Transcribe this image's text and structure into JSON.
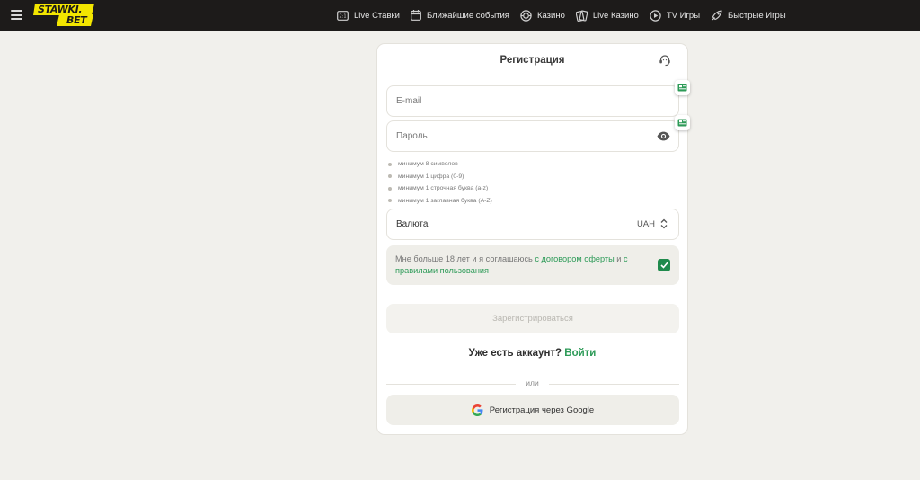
{
  "header": {
    "logo_top": "STAWKI.",
    "logo_bottom": "BET",
    "nav": [
      {
        "label": "Live Ставки",
        "icon": "live-bets-icon"
      },
      {
        "label": "Ближайшие события",
        "icon": "calendar-icon"
      },
      {
        "label": "Казино",
        "icon": "casino-chip-icon"
      },
      {
        "label": "Live Казино",
        "icon": "cards-icon"
      },
      {
        "label": "TV Игры",
        "icon": "tv-play-icon"
      },
      {
        "label": "Быстрые Игры",
        "icon": "rocket-icon"
      }
    ]
  },
  "form": {
    "title": "Регистрация",
    "email_placeholder": "E-mail",
    "password_placeholder": "Пароль",
    "password_rules": [
      "минимум 8 символов",
      "минимум 1 цифра (0-9)",
      "минимум 1 строчная буква (a-z)",
      "минимум 1 заглавная буква (A-Z)"
    ],
    "currency_label": "Валюта",
    "currency_value": "UAH",
    "agree_prefix": "Мне больше 18 лет и я соглашаюсь ",
    "agree_link1": "с договором оферты",
    "agree_mid": " и ",
    "agree_link2": "с правилами пользования",
    "agree_checked": true,
    "submit_label": "Зарегистрироваться",
    "have_account": "Уже есть аккаунт?",
    "login_link": "Войти",
    "or_label": "или",
    "google_label": "Регистрация через Google"
  },
  "colors": {
    "topbar": "#1d1b1a",
    "logo_yellow": "#f3e600",
    "accent_green": "#2c9a57",
    "page_bg": "#f1f0ec"
  }
}
